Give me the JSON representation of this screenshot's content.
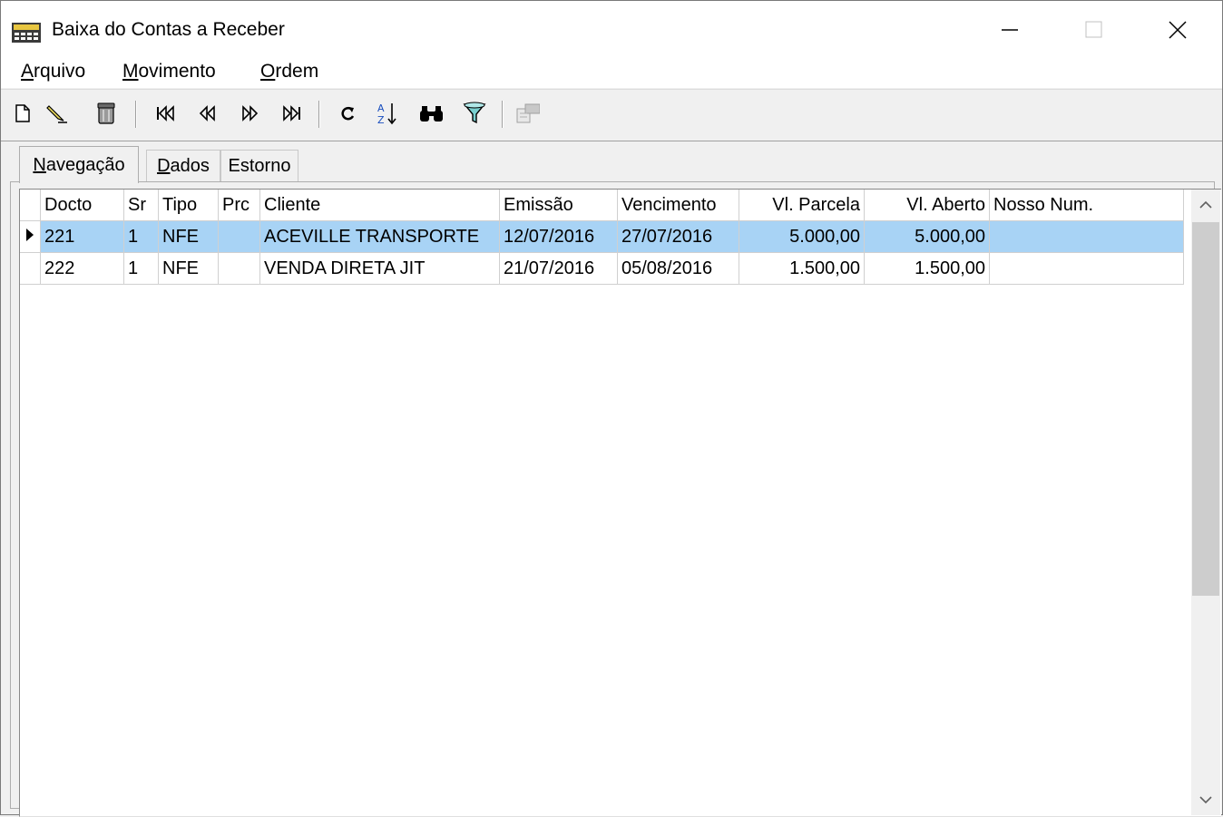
{
  "window": {
    "title": "Baixa do Contas a Receber"
  },
  "menu": [
    {
      "accel": "A",
      "rest": "rquivo"
    },
    {
      "accel": "M",
      "rest": "ovimento"
    },
    {
      "accel": "O",
      "rest": "rdem"
    }
  ],
  "toolbar": {
    "icons": [
      "new-document-icon",
      "edit-pencil-icon",
      "delete-trash-icon",
      "first-record-icon",
      "previous-record-icon",
      "next-record-icon",
      "last-record-icon",
      "refresh-icon",
      "sort-az-icon",
      "find-binoculars-icon",
      "filter-funnel-icon",
      "report-disabled-icon"
    ]
  },
  "tabs": [
    {
      "accel": "N",
      "rest": "avegação"
    },
    {
      "accel": "D",
      "rest": "ados"
    },
    {
      "accel": "",
      "rest": "Estorno"
    }
  ],
  "grid": {
    "columns": [
      "Docto",
      "Sr",
      "Tipo",
      "Prc",
      "Cliente",
      "Emissão",
      "Vencimento",
      "Vl. Parcela",
      "Vl. Aberto",
      "Nosso Num."
    ],
    "rows": [
      {
        "docto": "221",
        "sr": "1",
        "tipo": "NFE",
        "prc": "",
        "cliente": "ACEVILLE TRANSPORTE",
        "emissao": "12/07/2016",
        "vencimento": "27/07/2016",
        "vl_parcela": "5.000,00",
        "vl_aberto": "5.000,00",
        "nosso_num": ""
      },
      {
        "docto": "222",
        "sr": "1",
        "tipo": "NFE",
        "prc": "",
        "cliente": "VENDA DIRETA JIT",
        "emissao": "21/07/2016",
        "vencimento": "05/08/2016",
        "vl_parcela": "1.500,00",
        "vl_aberto": "1.500,00",
        "nosso_num": ""
      }
    ]
  },
  "colors": {
    "selection": "#a8d3f5"
  }
}
